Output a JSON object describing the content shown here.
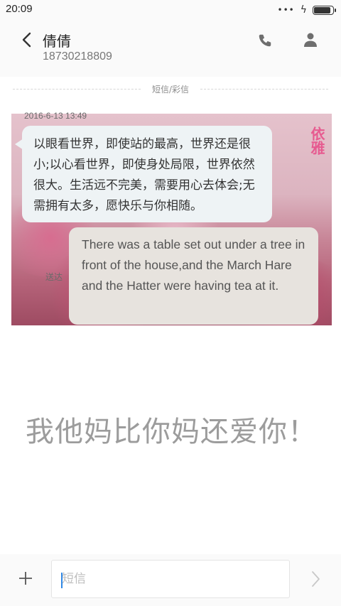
{
  "status_bar": {
    "time": "20:09",
    "signal_dots": "•••",
    "charging_symbol": "ϟ",
    "battery_level": 0.9
  },
  "header": {
    "contact_name": "倩倩",
    "contact_number": "18730218809"
  },
  "conversation": {
    "divider_label": "短信/彩信",
    "date_label": "2016-6-13 13:49",
    "sent_label": "送达",
    "stamp_text": "依雅",
    "bubble_left_text": "以眼看世界，即使站的最高，世界还是很小;以心看世界，即使身处局限，世界依然很大。生活远不完美，需要用心去体会;无需拥有太多，愿快乐与你相随。",
    "bubble_right_text": "There was a table set out under a tree in front of the house,and the March Hare and the Hatter were having tea at it."
  },
  "overlay_text": "我他妈比你妈还爱你！",
  "composer": {
    "placeholder": "短信",
    "value": ""
  },
  "icons": {
    "back": "chevron-left-icon",
    "call": "phone-icon",
    "profile": "person-icon",
    "attach": "plus-icon",
    "send": "chevron-right-icon"
  },
  "colors": {
    "accent_caret": "#2f88e6",
    "stamp": "#e84a87",
    "bubble_left_bg": "#eef3f5",
    "bubble_right_bg": "#e7e3de"
  }
}
